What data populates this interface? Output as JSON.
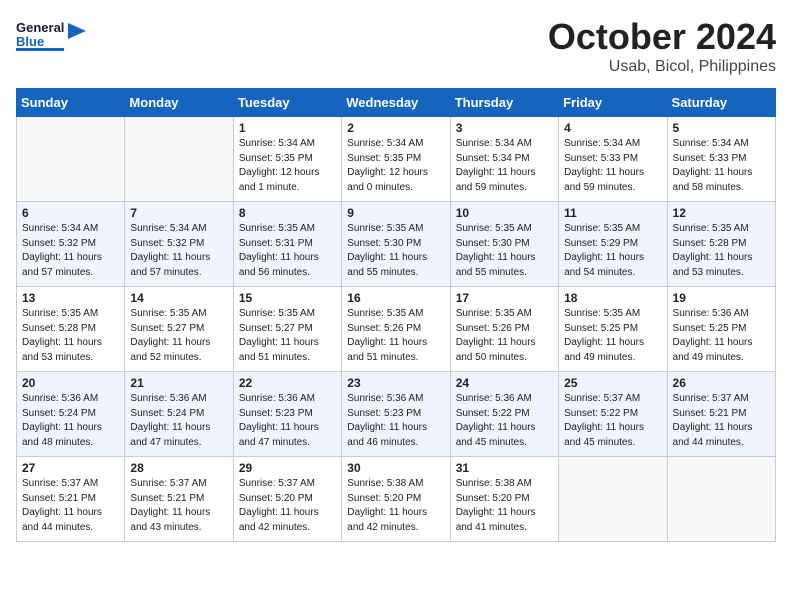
{
  "header": {
    "logo_general": "General",
    "logo_blue": "Blue",
    "month": "October 2024",
    "location": "Usab, Bicol, Philippines"
  },
  "weekdays": [
    "Sunday",
    "Monday",
    "Tuesday",
    "Wednesday",
    "Thursday",
    "Friday",
    "Saturday"
  ],
  "weeks": [
    [
      {
        "day": "",
        "info": ""
      },
      {
        "day": "",
        "info": ""
      },
      {
        "day": "1",
        "info": "Sunrise: 5:34 AM\nSunset: 5:35 PM\nDaylight: 12 hours\nand 1 minute."
      },
      {
        "day": "2",
        "info": "Sunrise: 5:34 AM\nSunset: 5:35 PM\nDaylight: 12 hours\nand 0 minutes."
      },
      {
        "day": "3",
        "info": "Sunrise: 5:34 AM\nSunset: 5:34 PM\nDaylight: 11 hours\nand 59 minutes."
      },
      {
        "day": "4",
        "info": "Sunrise: 5:34 AM\nSunset: 5:33 PM\nDaylight: 11 hours\nand 59 minutes."
      },
      {
        "day": "5",
        "info": "Sunrise: 5:34 AM\nSunset: 5:33 PM\nDaylight: 11 hours\nand 58 minutes."
      }
    ],
    [
      {
        "day": "6",
        "info": "Sunrise: 5:34 AM\nSunset: 5:32 PM\nDaylight: 11 hours\nand 57 minutes."
      },
      {
        "day": "7",
        "info": "Sunrise: 5:34 AM\nSunset: 5:32 PM\nDaylight: 11 hours\nand 57 minutes."
      },
      {
        "day": "8",
        "info": "Sunrise: 5:35 AM\nSunset: 5:31 PM\nDaylight: 11 hours\nand 56 minutes."
      },
      {
        "day": "9",
        "info": "Sunrise: 5:35 AM\nSunset: 5:30 PM\nDaylight: 11 hours\nand 55 minutes."
      },
      {
        "day": "10",
        "info": "Sunrise: 5:35 AM\nSunset: 5:30 PM\nDaylight: 11 hours\nand 55 minutes."
      },
      {
        "day": "11",
        "info": "Sunrise: 5:35 AM\nSunset: 5:29 PM\nDaylight: 11 hours\nand 54 minutes."
      },
      {
        "day": "12",
        "info": "Sunrise: 5:35 AM\nSunset: 5:28 PM\nDaylight: 11 hours\nand 53 minutes."
      }
    ],
    [
      {
        "day": "13",
        "info": "Sunrise: 5:35 AM\nSunset: 5:28 PM\nDaylight: 11 hours\nand 53 minutes."
      },
      {
        "day": "14",
        "info": "Sunrise: 5:35 AM\nSunset: 5:27 PM\nDaylight: 11 hours\nand 52 minutes."
      },
      {
        "day": "15",
        "info": "Sunrise: 5:35 AM\nSunset: 5:27 PM\nDaylight: 11 hours\nand 51 minutes."
      },
      {
        "day": "16",
        "info": "Sunrise: 5:35 AM\nSunset: 5:26 PM\nDaylight: 11 hours\nand 51 minutes."
      },
      {
        "day": "17",
        "info": "Sunrise: 5:35 AM\nSunset: 5:26 PM\nDaylight: 11 hours\nand 50 minutes."
      },
      {
        "day": "18",
        "info": "Sunrise: 5:35 AM\nSunset: 5:25 PM\nDaylight: 11 hours\nand 49 minutes."
      },
      {
        "day": "19",
        "info": "Sunrise: 5:36 AM\nSunset: 5:25 PM\nDaylight: 11 hours\nand 49 minutes."
      }
    ],
    [
      {
        "day": "20",
        "info": "Sunrise: 5:36 AM\nSunset: 5:24 PM\nDaylight: 11 hours\nand 48 minutes."
      },
      {
        "day": "21",
        "info": "Sunrise: 5:36 AM\nSunset: 5:24 PM\nDaylight: 11 hours\nand 47 minutes."
      },
      {
        "day": "22",
        "info": "Sunrise: 5:36 AM\nSunset: 5:23 PM\nDaylight: 11 hours\nand 47 minutes."
      },
      {
        "day": "23",
        "info": "Sunrise: 5:36 AM\nSunset: 5:23 PM\nDaylight: 11 hours\nand 46 minutes."
      },
      {
        "day": "24",
        "info": "Sunrise: 5:36 AM\nSunset: 5:22 PM\nDaylight: 11 hours\nand 45 minutes."
      },
      {
        "day": "25",
        "info": "Sunrise: 5:37 AM\nSunset: 5:22 PM\nDaylight: 11 hours\nand 45 minutes."
      },
      {
        "day": "26",
        "info": "Sunrise: 5:37 AM\nSunset: 5:21 PM\nDaylight: 11 hours\nand 44 minutes."
      }
    ],
    [
      {
        "day": "27",
        "info": "Sunrise: 5:37 AM\nSunset: 5:21 PM\nDaylight: 11 hours\nand 44 minutes."
      },
      {
        "day": "28",
        "info": "Sunrise: 5:37 AM\nSunset: 5:21 PM\nDaylight: 11 hours\nand 43 minutes."
      },
      {
        "day": "29",
        "info": "Sunrise: 5:37 AM\nSunset: 5:20 PM\nDaylight: 11 hours\nand 42 minutes."
      },
      {
        "day": "30",
        "info": "Sunrise: 5:38 AM\nSunset: 5:20 PM\nDaylight: 11 hours\nand 42 minutes."
      },
      {
        "day": "31",
        "info": "Sunrise: 5:38 AM\nSunset: 5:20 PM\nDaylight: 11 hours\nand 41 minutes."
      },
      {
        "day": "",
        "info": ""
      },
      {
        "day": "",
        "info": ""
      }
    ]
  ]
}
